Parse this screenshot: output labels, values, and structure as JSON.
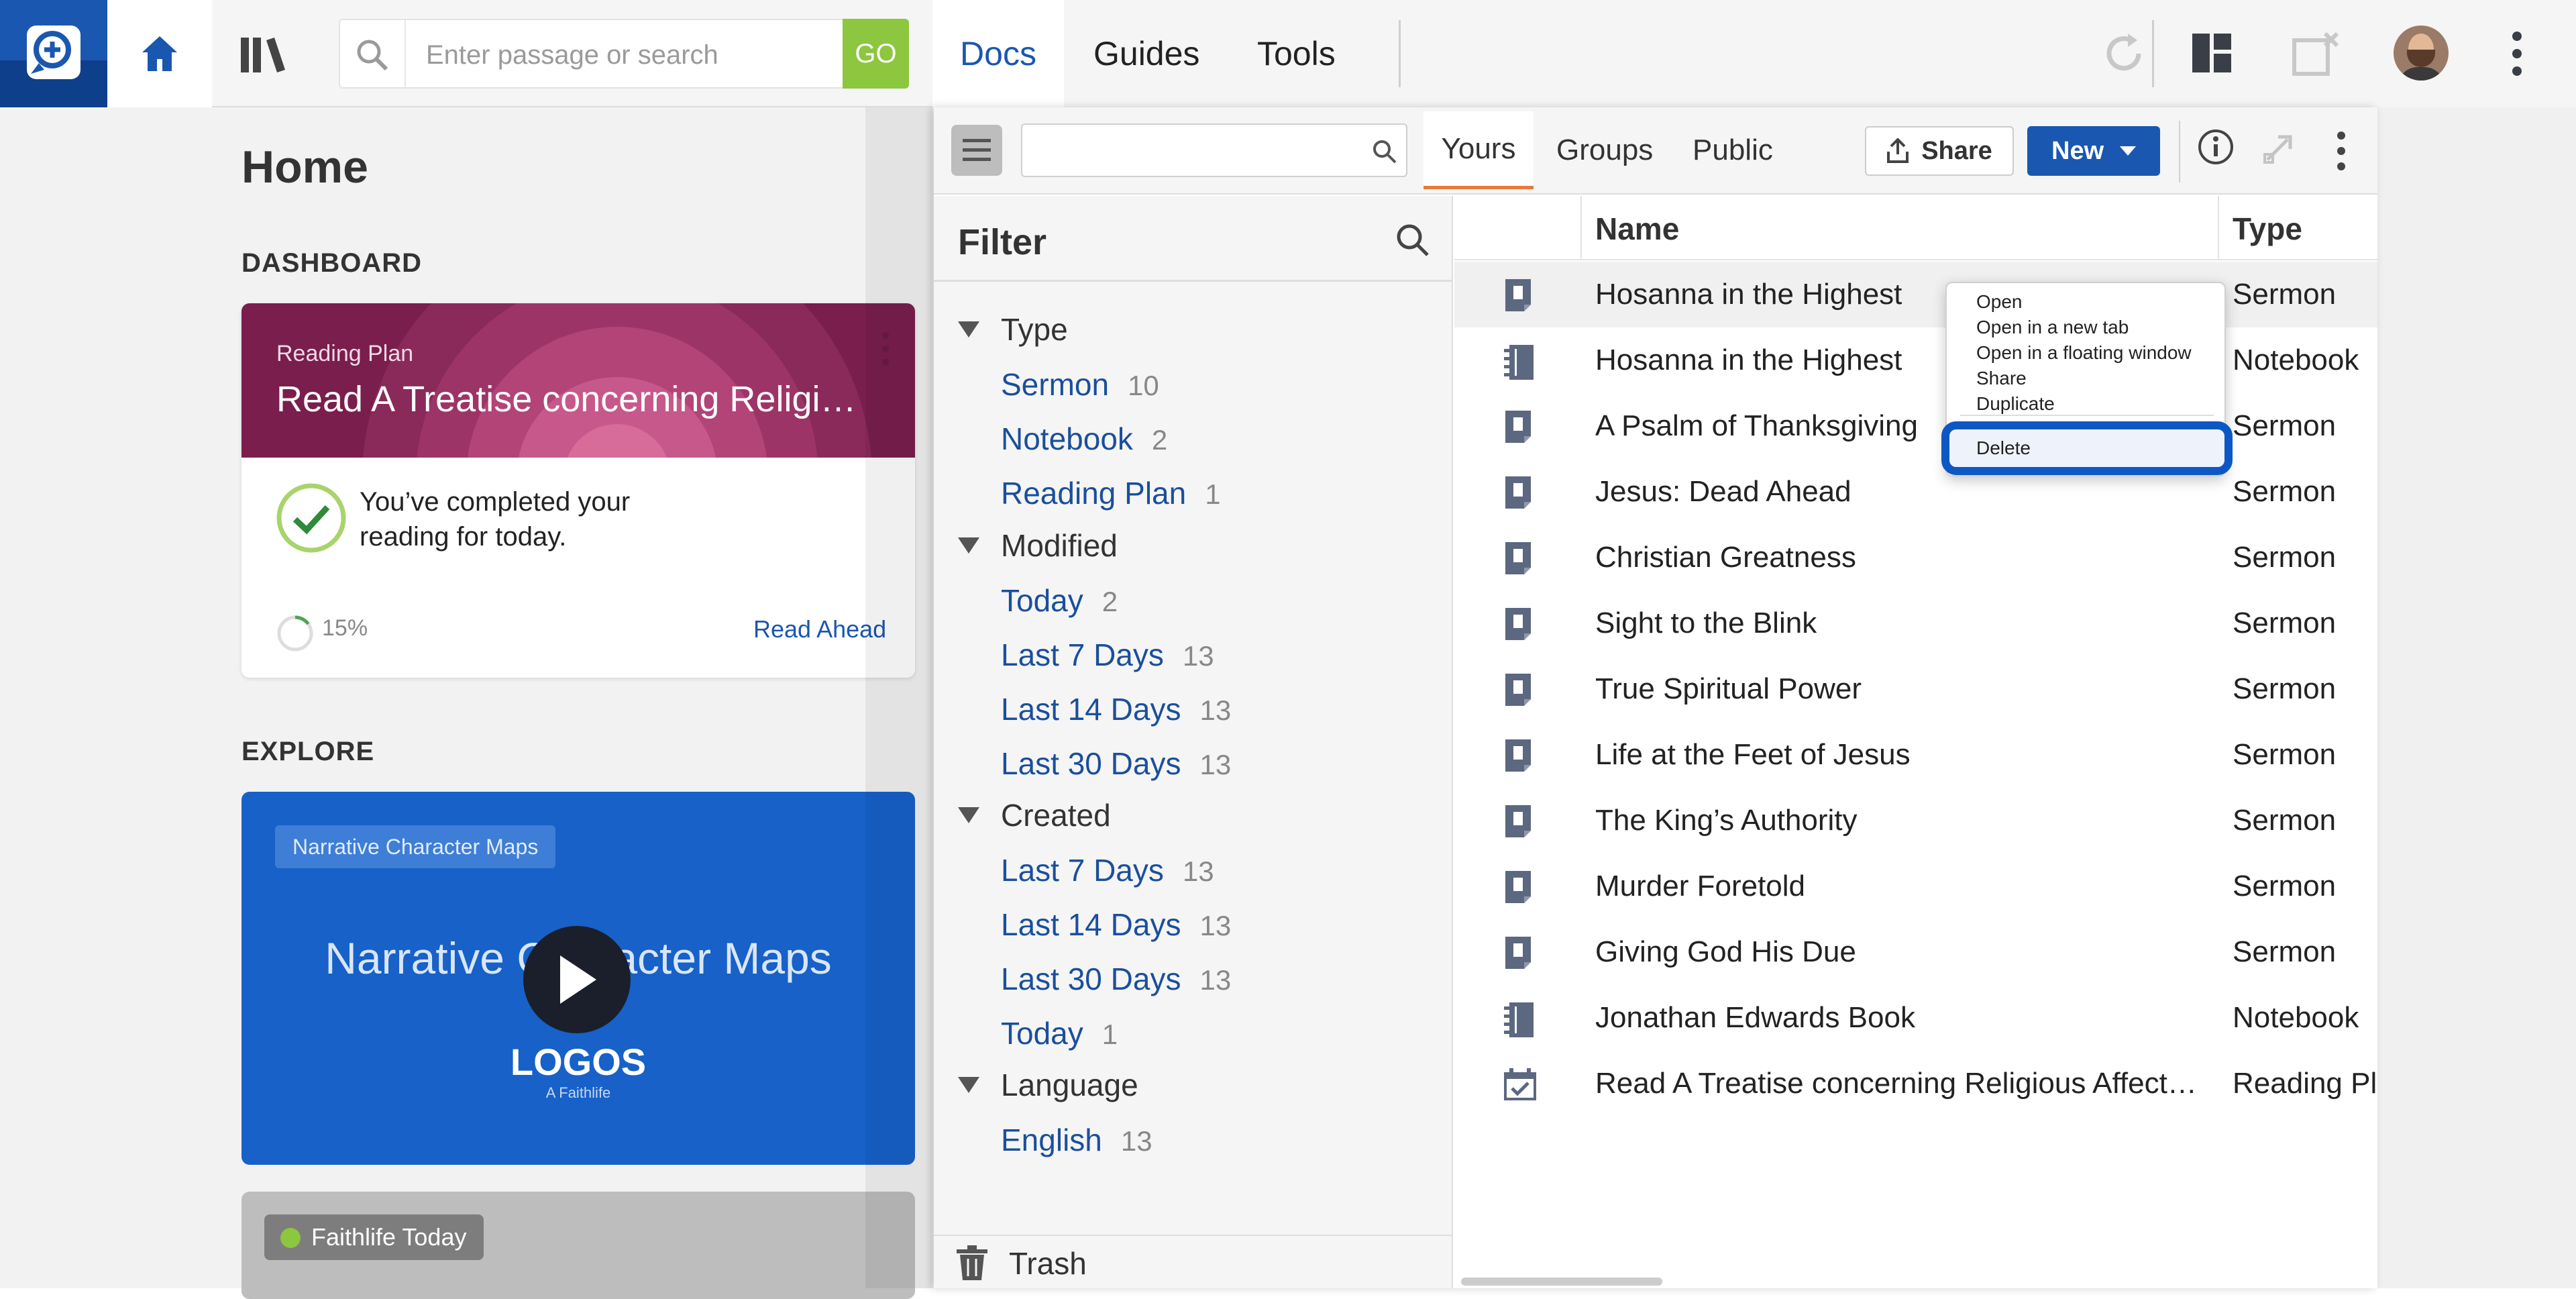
{
  "header": {
    "search_placeholder": "Enter passage or search",
    "go_label": "GO",
    "tabs": [
      {
        "label": "Docs",
        "active": true
      },
      {
        "label": "Guides",
        "active": false
      },
      {
        "label": "Tools",
        "active": false
      }
    ],
    "icons": [
      "logos-logo-icon",
      "home-icon",
      "library-icon",
      "search-icon",
      "sync-icon",
      "layout-icon",
      "close-panel-icon",
      "avatar",
      "more-vertical-icon"
    ]
  },
  "home": {
    "title": "Home",
    "dashboard_label": "DASHBOARD",
    "reading_plan": {
      "kicker": "Reading Plan",
      "title": "Read A Treatise concerning Religi…",
      "completed_text": "You’ve completed your reading for today.",
      "progress_label": "15%",
      "progress_value": 0.15,
      "link": "Read Ahead"
    },
    "explore_label": "EXPLORE",
    "video": {
      "tag": "Narrative Character Maps",
      "title": "Narrative Character Maps",
      "brand": "LOGOS",
      "brand_sub": "A Faithlife"
    },
    "faithlife_today": {
      "label": "Faithlife Today"
    }
  },
  "docs": {
    "panel_tabs": [
      {
        "label": "Yours",
        "active": true
      },
      {
        "label": "Groups",
        "active": false
      },
      {
        "label": "Public",
        "active": false
      }
    ],
    "share_label": "Share",
    "new_label": "New",
    "filter": {
      "title": "Filter",
      "groups": [
        {
          "label": "Type",
          "items": [
            {
              "label": "Sermon",
              "count": "10"
            },
            {
              "label": "Notebook",
              "count": "2"
            },
            {
              "label": "Reading Plan",
              "count": "1"
            }
          ]
        },
        {
          "label": "Modified",
          "items": [
            {
              "label": "Today",
              "count": "2"
            },
            {
              "label": "Last 7 Days",
              "count": "13"
            },
            {
              "label": "Last 14 Days",
              "count": "13"
            },
            {
              "label": "Last 30 Days",
              "count": "13"
            }
          ]
        },
        {
          "label": "Created",
          "items": [
            {
              "label": "Last 7 Days",
              "count": "13"
            },
            {
              "label": "Last 14 Days",
              "count": "13"
            },
            {
              "label": "Last 30 Days",
              "count": "13"
            },
            {
              "label": "Today",
              "count": "1"
            }
          ]
        },
        {
          "label": "Language",
          "items": [
            {
              "label": "English",
              "count": "13"
            }
          ]
        }
      ],
      "trash_label": "Trash"
    },
    "columns": {
      "name": "Name",
      "type": "Type"
    },
    "rows": [
      {
        "name": "Hosanna in the Highest",
        "type": "Sermon",
        "icon": "sermon-icon"
      },
      {
        "name": "Hosanna in the Highest",
        "type": "Notebook",
        "icon": "notebook-icon"
      },
      {
        "name": "A Psalm of Thanksgiving",
        "type": "Sermon",
        "icon": "sermon-icon"
      },
      {
        "name": "Jesus: Dead Ahead",
        "type": "Sermon",
        "icon": "sermon-icon"
      },
      {
        "name": "Christian Greatness",
        "type": "Sermon",
        "icon": "sermon-icon"
      },
      {
        "name": "Sight to the Blink",
        "type": "Sermon",
        "icon": "sermon-icon"
      },
      {
        "name": "True Spiritual Power",
        "type": "Sermon",
        "icon": "sermon-icon"
      },
      {
        "name": "Life at the Feet of Jesus",
        "type": "Sermon",
        "icon": "sermon-icon"
      },
      {
        "name": "The King’s Authority",
        "type": "Sermon",
        "icon": "sermon-icon"
      },
      {
        "name": "Murder Foretold",
        "type": "Sermon",
        "icon": "sermon-icon"
      },
      {
        "name": "Giving God His Due",
        "type": "Sermon",
        "icon": "sermon-icon"
      },
      {
        "name": "Jonathan Edwards Book",
        "type": "Notebook",
        "icon": "notebook-icon"
      },
      {
        "name": "Read A Treatise concerning Religious Affection…",
        "type": "Reading Plan",
        "icon": "reading-plan-icon"
      }
    ],
    "context_menu": {
      "items": [
        "Open",
        "Open in a new tab",
        "Open in a floating window",
        "Share",
        "Duplicate"
      ],
      "delete_label": "Delete"
    }
  },
  "colors": {
    "accent": "#1a57b0",
    "go": "#8dc63f",
    "tab_underline": "#e8793a",
    "highlight": "#0d57c4"
  }
}
